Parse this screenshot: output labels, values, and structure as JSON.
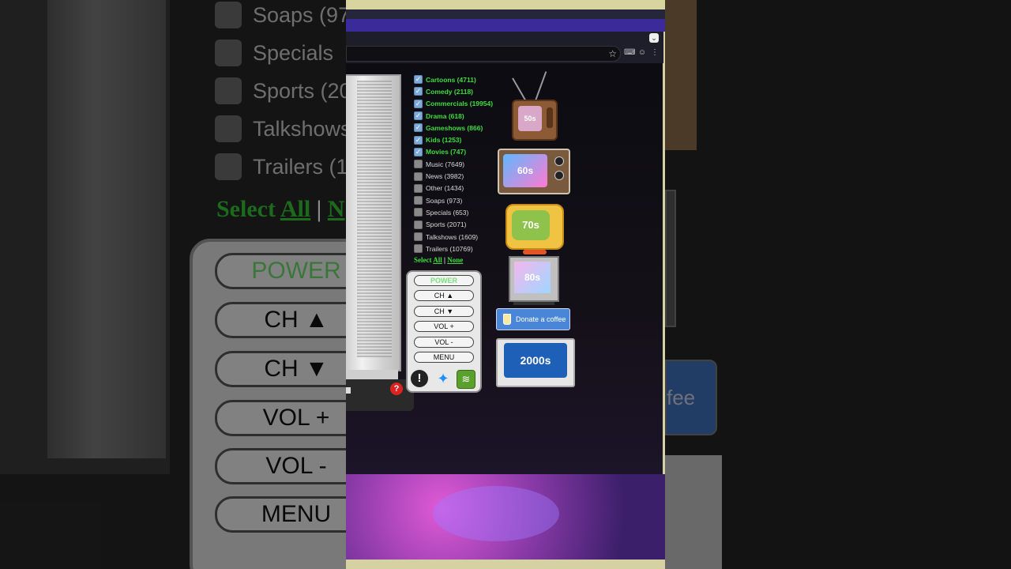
{
  "browser": {
    "dropdown_label": "⌄",
    "star_icon": "star-icon",
    "toolbar_icons": [
      "translate-icon",
      "profile-icon",
      "more-icon"
    ]
  },
  "categories": [
    {
      "label": "Cartoons (4711)",
      "checked": true
    },
    {
      "label": "Comedy (2118)",
      "checked": true
    },
    {
      "label": "Commercials (19954)",
      "checked": true
    },
    {
      "label": "Drama (618)",
      "checked": true
    },
    {
      "label": "Gameshows (866)",
      "checked": true
    },
    {
      "label": "Kids (1253)",
      "checked": true
    },
    {
      "label": "Movies (747)",
      "checked": true
    },
    {
      "label": "Music (7649)",
      "checked": false
    },
    {
      "label": "News (3982)",
      "checked": false
    },
    {
      "label": "Other (1434)",
      "checked": false
    },
    {
      "label": "Soaps (973)",
      "checked": false
    },
    {
      "label": "Specials (653)",
      "checked": false
    },
    {
      "label": "Sports (2071)",
      "checked": false
    },
    {
      "label": "Talkshows (1609)",
      "checked": false
    },
    {
      "label": "Trailers (10769)",
      "checked": false
    }
  ],
  "select": {
    "prefix": "Select",
    "all": "All",
    "separator": "|",
    "none": "None"
  },
  "remote": {
    "power": "POWER",
    "ch_up": "CH ▲",
    "ch_down": "CH ▼",
    "vol_up": "VOL +",
    "vol_down": "VOL -",
    "menu": "MENU",
    "alert_glyph": "!",
    "help_glyph": "?"
  },
  "decades": {
    "tv50": "50s",
    "tv60": "60s",
    "tv70": "70s",
    "tv80": "80s",
    "tv00": "2000s"
  },
  "donate": {
    "label": "Donate a coffee"
  },
  "background_echo": {
    "rows": [
      "Soaps (97",
      "Specials",
      "Sports (20",
      "Talkshows",
      "Trailers (1"
    ],
    "select_prefix": "Select",
    "select_all": "All",
    "select_sep": "|",
    "select_none": "N",
    "remote": [
      "POWER",
      "CH ▲",
      "CH ▼",
      "VOL +",
      "VOL -",
      "MENU"
    ],
    "coffee_fragment": "fee"
  },
  "colors": {
    "checked_label": "#3ddc3d",
    "unchecked_label": "#d8d8d8",
    "donate_bg": "#4a86d8",
    "chrome_purple": "#3a2a9a"
  }
}
